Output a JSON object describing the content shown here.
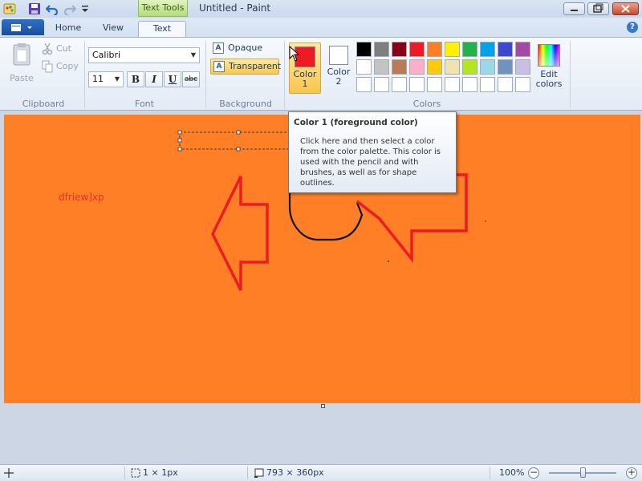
{
  "window": {
    "title": "Untitled - Paint",
    "context_tab_group": "Text Tools"
  },
  "tabs": [
    "Home",
    "View",
    "Text"
  ],
  "active_tab": "Text",
  "clipboard": {
    "paste": "Paste",
    "cut": "Cut",
    "copy": "Copy",
    "group_label": "Clipboard"
  },
  "font": {
    "family": "Calibri",
    "size": "11",
    "bold": "B",
    "italic": "I",
    "underline": "U",
    "strikethrough": "abc",
    "group_label": "Font"
  },
  "background": {
    "opaque": "Opaque",
    "transparent": "Transparent",
    "selected": "Transparent",
    "group_label": "Background"
  },
  "colors": {
    "color1_label_1": "Color",
    "color1_label_2": "1",
    "color2_label_1": "Color",
    "color2_label_2": "2",
    "color1_value": "#ed1c24",
    "color2_value": "#ffffff",
    "edit_colors_1": "Edit",
    "edit_colors_2": "colors",
    "group_label": "Colors",
    "palette_row1": [
      "#000000",
      "#7f7f7f",
      "#880015",
      "#ed1c24",
      "#ff7f27",
      "#fff200",
      "#22b14c",
      "#00a2e8",
      "#3f48cc",
      "#a349a4"
    ],
    "palette_row2": [
      "#ffffff",
      "#c3c3c3",
      "#b97a57",
      "#ffaec9",
      "#ffc90e",
      "#efe4b0",
      "#b5e61d",
      "#99d9ea",
      "#7092be",
      "#c8bfe7"
    ],
    "palette_row3": [
      "#ffffff",
      "#ffffff",
      "#ffffff",
      "#ffffff",
      "#ffffff",
      "#ffffff",
      "#ffffff",
      "#ffffff",
      "#ffffff",
      "#ffffff"
    ]
  },
  "tooltip": {
    "title": "Color 1 (foreground color)",
    "body": "Click here and then select a color from the color palette. This color is used with the pencil  and with brushes, as well as for shape outlines."
  },
  "canvas": {
    "background_color": "#ff7f27",
    "text": "dfriew]xp",
    "text_color": "#e4312b"
  },
  "status": {
    "cursor_size": "1 × 1px",
    "canvas_size": "793 × 360px",
    "zoom": "100%",
    "zoom_level_fraction": 0.5
  },
  "icons": [
    "save-icon",
    "undo-icon",
    "redo-icon",
    "paint-app-icon",
    "help-icon",
    "paste-icon",
    "cut-icon",
    "copy-icon",
    "selection-icon",
    "canvas-size-icon",
    "zoom-out-icon",
    "zoom-in-icon"
  ]
}
